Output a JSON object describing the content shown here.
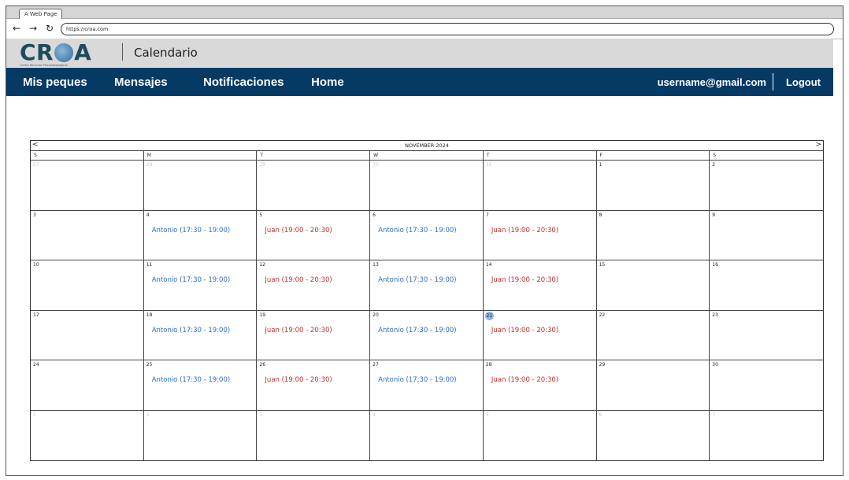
{
  "browser": {
    "tab_label": "A Web Page",
    "back_icon": "arrow-left-icon",
    "forward_icon": "arrow-right-icon",
    "reload_icon": "reload-icon",
    "url": "https://croa.com"
  },
  "header": {
    "logo_text_left": "CR",
    "logo_text_right": "A",
    "logo_subtitle": "Centro Recursos Psicopedagógicos",
    "title": "Calendario"
  },
  "nav": {
    "items": [
      "Mis peques",
      "Mensajes",
      "Notificaciones",
      "Home"
    ],
    "user": "username@gmail.com",
    "logout": "Logout"
  },
  "calendar": {
    "month_label": "NOVEMBER 2024",
    "prev_label": "<",
    "next_label": ">",
    "weekdays": [
      "S",
      "M",
      "T",
      "W",
      "T",
      "F",
      "S"
    ],
    "colors": {
      "antonio": "#2f6fc4",
      "juan": "#c0302b"
    },
    "days": [
      {
        "n": "27",
        "muted": true
      },
      {
        "n": "28",
        "muted": true
      },
      {
        "n": "29",
        "muted": true
      },
      {
        "n": "30",
        "muted": true
      },
      {
        "n": "31",
        "muted": true
      },
      {
        "n": "1"
      },
      {
        "n": "2"
      },
      {
        "n": "3"
      },
      {
        "n": "4",
        "event": "Antonio (17:30 - 19:00)",
        "who": "antonio"
      },
      {
        "n": "5",
        "event": "Juan (19:00 - 20:30)",
        "who": "juan"
      },
      {
        "n": "6",
        "event": "Antonio (17:30 - 19:00)",
        "who": "antonio"
      },
      {
        "n": "7",
        "event": "Juan (19:00 - 20:30)",
        "who": "juan"
      },
      {
        "n": "8"
      },
      {
        "n": "9"
      },
      {
        "n": "10"
      },
      {
        "n": "11",
        "event": "Antonio (17:30 - 19:00)",
        "who": "antonio"
      },
      {
        "n": "12",
        "event": "Juan (19:00 - 20:30)",
        "who": "juan"
      },
      {
        "n": "13",
        "event": "Antonio (17:30 - 19:00)",
        "who": "antonio"
      },
      {
        "n": "14",
        "event": "Juan (19:00 - 20:30)",
        "who": "juan"
      },
      {
        "n": "15"
      },
      {
        "n": "16"
      },
      {
        "n": "17"
      },
      {
        "n": "18",
        "event": "Antonio (17:30 - 19:00)",
        "who": "antonio"
      },
      {
        "n": "19",
        "event": "Juan (19:00 - 20:30)",
        "who": "juan"
      },
      {
        "n": "20",
        "event": "Antonio (17:30 - 19:00)",
        "who": "antonio"
      },
      {
        "n": "21",
        "today": true,
        "event": "Juan (19:00 - 20:30)",
        "who": "juan"
      },
      {
        "n": "22"
      },
      {
        "n": "23"
      },
      {
        "n": "24"
      },
      {
        "n": "25",
        "event": "Antonio (17:30 - 19:00)",
        "who": "antonio"
      },
      {
        "n": "26",
        "event": "Juan (19:00 - 20:30)",
        "who": "juan"
      },
      {
        "n": "27",
        "event": "Antonio (17:30 - 19:00)",
        "who": "antonio"
      },
      {
        "n": "28",
        "event": "Juan (19:00 - 20:30)",
        "who": "juan"
      },
      {
        "n": "29"
      },
      {
        "n": "30"
      },
      {
        "n": "1",
        "muted": true
      },
      {
        "n": "2",
        "muted": true
      },
      {
        "n": "3",
        "muted": true
      },
      {
        "n": "4",
        "muted": true
      },
      {
        "n": "5",
        "muted": true
      },
      {
        "n": "6",
        "muted": true
      },
      {
        "n": "7",
        "muted": true
      }
    ]
  }
}
